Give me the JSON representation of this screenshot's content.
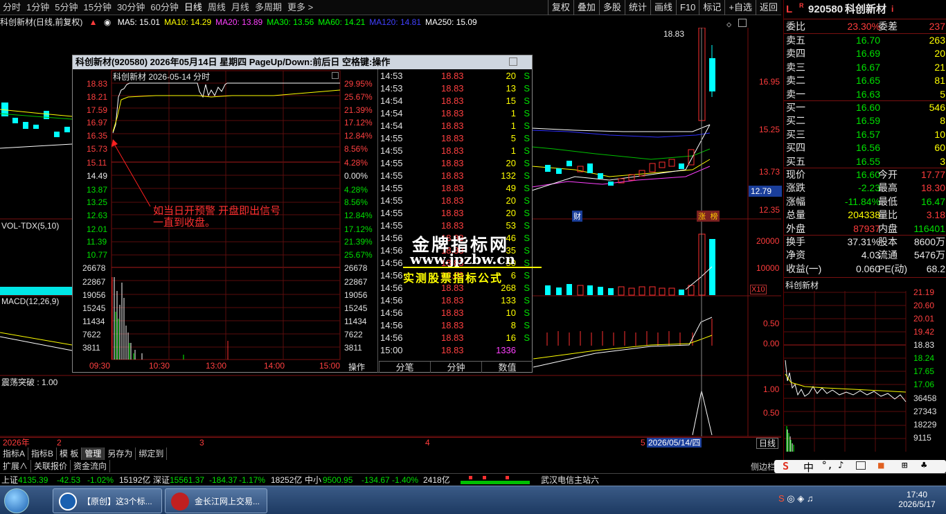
{
  "topbar": {
    "tabs": [
      "分时",
      "1分钟",
      "5分钟",
      "15分钟",
      "30分钟",
      "60分钟",
      "日线",
      "周线",
      "月线",
      "多周期",
      "更多 >"
    ],
    "tools": [
      "复权",
      "叠加",
      "多股",
      "统计",
      "画线",
      "F10",
      "标记",
      "+自选",
      "返回"
    ]
  },
  "chart_header": {
    "title": "科创新材(日线,前复权)",
    "ma": [
      {
        "label": "MA5: 15.01",
        "color": "#ffffff"
      },
      {
        "label": "MA10: 14.29",
        "color": "#ffff00"
      },
      {
        "label": "MA20: 13.89",
        "color": "#ff40ff"
      },
      {
        "label": "MA30: 13.56",
        "color": "#00ff00"
      },
      {
        "label": "MA60: 14.21",
        "color": "#00ff00"
      },
      {
        "label": "MA120: 14.81",
        "color": "#4040ff"
      },
      {
        "label": "MA250: 15.09",
        "color": "#ffffff"
      }
    ]
  },
  "main_axis": [
    "18.83",
    "16.95",
    "15.25",
    "13.73",
    "12.79",
    "12.35"
  ],
  "vol_panel": {
    "title": "VOL-TDX(5,10)",
    "axis": [
      "20000",
      "10000",
      "X10"
    ]
  },
  "macd_panel": {
    "title": "MACD(12,26,9)",
    "axis": [
      "0.50",
      "0.00"
    ]
  },
  "zd_panel": {
    "title": "震荡突破 : 1.00",
    "axis": [
      "1.00",
      "0.50"
    ]
  },
  "markers": {
    "cai": "财",
    "zhangbang": "涨 榜"
  },
  "time_axis": {
    "year": "2026年",
    "m2": "2",
    "m3": "3",
    "m4": "4",
    "m5": "5",
    "cursor_date": "2026/05/14/四",
    "period": "日线"
  },
  "popup": {
    "title": "科创新材(920580)  2026年05月14日 星期四  PageUp/Down:前后日  空格键:操作",
    "chart_title": "科创新材   2026-05-14 分时",
    "price_labels": [
      "18.83",
      "18.21",
      "17.59",
      "16.97",
      "16.35",
      "15.73",
      "15.11",
      "14.49",
      "13.87",
      "13.25",
      "12.63",
      "12.01",
      "11.39",
      "10.77"
    ],
    "pct_labels": [
      "29.95%",
      "25.67%",
      "21.39%",
      "17.12%",
      "12.84%",
      "8.56%",
      "4.28%",
      "0.00%",
      "4.28%",
      "8.56%",
      "12.84%",
      "17.12%",
      "21.39%",
      "25.67%"
    ],
    "vol_labels": [
      "26678",
      "22867",
      "19056",
      "15245",
      "11434",
      "7622",
      "3811"
    ],
    "time_labels": [
      "09:30",
      "10:30",
      "13:00",
      "14:00",
      "15:00"
    ],
    "annotation_line1": "如当日开预警  开盘即出信号",
    "annotation_line2": "一直到收盘。",
    "op_label": "操作",
    "buttons": [
      "分笔",
      "分钟",
      "数值"
    ],
    "ticks": [
      {
        "t": "14:53",
        "p": "18.83",
        "v": "20",
        "s": "S"
      },
      {
        "t": "14:53",
        "p": "18.83",
        "v": "13",
        "s": "S"
      },
      {
        "t": "14:54",
        "p": "18.83",
        "v": "15",
        "s": "S"
      },
      {
        "t": "14:54",
        "p": "18.83",
        "v": "1",
        "s": "S"
      },
      {
        "t": "14:54",
        "p": "18.83",
        "v": "1",
        "s": "S"
      },
      {
        "t": "14:55",
        "p": "18.83",
        "v": "5",
        "s": "S"
      },
      {
        "t": "14:55",
        "p": "18.83",
        "v": "1",
        "s": "S"
      },
      {
        "t": "14:55",
        "p": "18.83",
        "v": "20",
        "s": "S"
      },
      {
        "t": "14:55",
        "p": "18.83",
        "v": "132",
        "s": "S"
      },
      {
        "t": "14:55",
        "p": "18.83",
        "v": "49",
        "s": "S"
      },
      {
        "t": "14:55",
        "p": "18.83",
        "v": "20",
        "s": "S"
      },
      {
        "t": "14:55",
        "p": "18.83",
        "v": "20",
        "s": "S"
      },
      {
        "t": "14:55",
        "p": "18.83",
        "v": "53",
        "s": "S"
      },
      {
        "t": "14:56",
        "p": "18.83",
        "v": "46",
        "s": "S"
      },
      {
        "t": "14:56",
        "p": "18.83",
        "v": "35",
        "s": "S"
      },
      {
        "t": "14:56",
        "p": "18.83",
        "v": "50",
        "s": "S"
      },
      {
        "t": "14:56",
        "p": "18.83",
        "v": "6",
        "s": "S"
      },
      {
        "t": "14:56",
        "p": "18.83",
        "v": "268",
        "s": "S"
      },
      {
        "t": "14:56",
        "p": "18.83",
        "v": "133",
        "s": "S"
      },
      {
        "t": "14:56",
        "p": "18.83",
        "v": "10",
        "s": "S"
      },
      {
        "t": "14:56",
        "p": "18.83",
        "v": "8",
        "s": "S"
      },
      {
        "t": "14:56",
        "p": "18.83",
        "v": "16",
        "s": "S"
      },
      {
        "t": "15:00",
        "p": "18.83",
        "v": "1336",
        "s": ""
      }
    ]
  },
  "watermark": {
    "line1": "金牌指标网",
    "line2": "www.jpzbw.cn",
    "line3": "实测股票指标公式"
  },
  "right_panel": {
    "code": "920580",
    "name": "科创新材",
    "weibi": {
      "label": "委比",
      "value": "23.30%",
      "label2": "委差",
      "value2": "237"
    },
    "asks": [
      {
        "label": "卖五",
        "price": "16.70",
        "vol": "263"
      },
      {
        "label": "卖四",
        "price": "16.69",
        "vol": "20"
      },
      {
        "label": "卖三",
        "price": "16.67",
        "vol": "21"
      },
      {
        "label": "卖二",
        "price": "16.65",
        "vol": "81"
      },
      {
        "label": "卖一",
        "price": "16.63",
        "vol": "5"
      }
    ],
    "bids": [
      {
        "label": "买一",
        "price": "16.60",
        "vol": "546"
      },
      {
        "label": "买二",
        "price": "16.59",
        "vol": "8"
      },
      {
        "label": "买三",
        "price": "16.57",
        "vol": "10"
      },
      {
        "label": "买四",
        "price": "16.56",
        "vol": "60"
      },
      {
        "label": "买五",
        "price": "16.55",
        "vol": "3"
      }
    ],
    "stats": [
      {
        "l": "现价",
        "v": "16.60",
        "l2": "今开",
        "v2": "17.77"
      },
      {
        "l": "涨跌",
        "v": "-2.23",
        "l2": "最高",
        "v2": "18.30"
      },
      {
        "l": "涨幅",
        "v": "-11.84%",
        "l2": "最低",
        "v2": "16.47"
      },
      {
        "l": "总量",
        "v": "204338",
        "l2": "量比",
        "v2": "3.18"
      },
      {
        "l": "外盘",
        "v": "87937",
        "l2": "内盘",
        "v2": "116401"
      }
    ],
    "stats2": [
      {
        "l": "换手",
        "v": "37.31%",
        "l2": "股本",
        "v2": "8600万"
      },
      {
        "l": "净资",
        "v": "4.03",
        "l2": "流通",
        "v2": "5476万"
      },
      {
        "l": "收益(一)",
        "v": "0.060",
        "l2": "PE(动)",
        "v2": "68.2"
      }
    ],
    "mini_title": "科创新材",
    "mini_axis": [
      "21.19",
      "20.60",
      "20.01",
      "19.42",
      "18.83",
      "18.24",
      "17.65",
      "17.06",
      "36458",
      "27343",
      "18229",
      "9115"
    ]
  },
  "bottom_tabs": [
    "指标A",
    "指标B",
    "模 板",
    "管理",
    "另存为",
    "绑定到"
  ],
  "bottom_tabs2": [
    "扩展∧",
    "关联报价",
    "资金流向"
  ],
  "status": {
    "sh_label": "上证",
    "sh_val": "4135.39",
    "sh_chg": "-42.53",
    "sh_pct": "-1.02%",
    "sh_amt": "15192亿",
    "sz_label": "深证",
    "sz_val": "15561.37",
    "sz_chg": "-184.37",
    "sz_pct": "-1.17%",
    "sz_amt": "18252亿",
    "zx_label": "中小",
    "zx_val": "9500.95",
    "zx_chg": "-134.67",
    "zx_pct": "-1.40%",
    "zx_amt": "2418亿",
    "server": "武汉电信主站六"
  },
  "taskbar": {
    "btn1": "【原创】这3个标...",
    "btn2": "金长江网上交易...",
    "time": "17:40",
    "date": "2026/5/17",
    "ime": "中"
  }
}
